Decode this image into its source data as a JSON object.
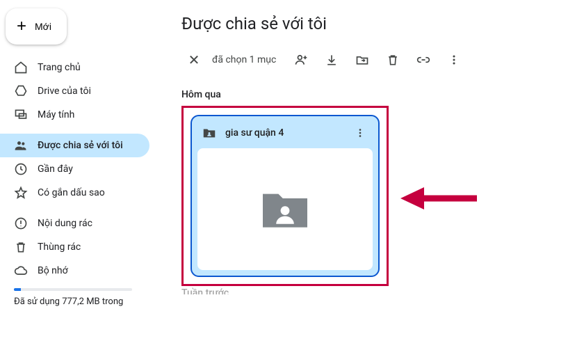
{
  "new_button": {
    "label": "Mới"
  },
  "sidebar": {
    "items": [
      {
        "label": "Trang chủ"
      },
      {
        "label": "Drive của tôi"
      },
      {
        "label": "Máy tính"
      },
      {
        "label": "Được chia sẻ với tôi"
      },
      {
        "label": "Gần đây"
      },
      {
        "label": "Có gắn dấu sao"
      },
      {
        "label": "Nội dung rác"
      },
      {
        "label": "Thùng rác"
      },
      {
        "label": "Bộ nhớ"
      }
    ],
    "storage_text": "Đã sử dụng 777,2 MB trong"
  },
  "main": {
    "title": "Được chia sẻ với tôi",
    "action_bar": {
      "selected_text": "đã chọn 1 mục"
    },
    "sections": [
      {
        "label": "Hôm qua"
      },
      {
        "label": "Tuần trước"
      }
    ],
    "folder": {
      "title": "gia sư quận 4"
    }
  }
}
